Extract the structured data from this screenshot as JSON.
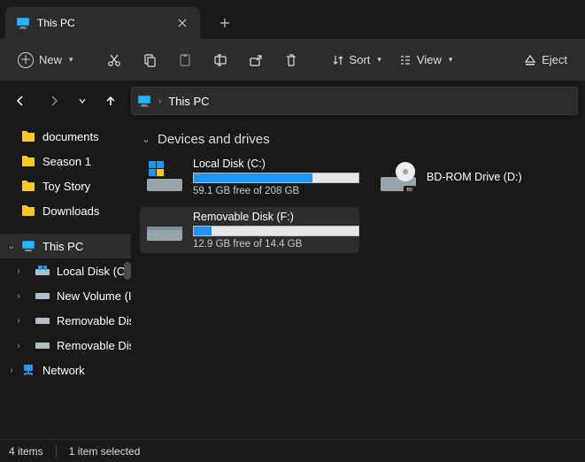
{
  "tab": {
    "title": "This PC"
  },
  "toolbar": {
    "new_label": "New",
    "sort_label": "Sort",
    "view_label": "View",
    "eject_label": "Eject"
  },
  "breadcrumb": {
    "location": "This PC"
  },
  "quick_access": [
    {
      "label": "documents"
    },
    {
      "label": "Season 1"
    },
    {
      "label": "Toy Story"
    },
    {
      "label": "Downloads"
    }
  ],
  "tree": {
    "this_pc": "This PC",
    "children": [
      {
        "label": "Local Disk (C:)"
      },
      {
        "label": "New Volume (I"
      },
      {
        "label": "Removable Dis"
      },
      {
        "label": "Removable Disk"
      }
    ],
    "network": "Network"
  },
  "section_title": "Devices and drives",
  "drives": [
    {
      "name": "Local Disk (C:)",
      "free_text": "59.1 GB free of 208 GB",
      "fill_pct": 72,
      "type": "os"
    },
    {
      "name": "BD-ROM Drive (D:)",
      "type": "optical"
    },
    {
      "name": "Removable Disk (F:)",
      "free_text": "12.9 GB free of 14.4 GB",
      "fill_pct": 11,
      "type": "removable"
    }
  ],
  "status": {
    "count": "4 items",
    "selection": "1 item selected"
  }
}
